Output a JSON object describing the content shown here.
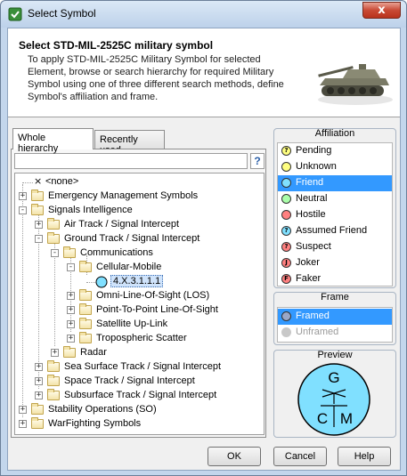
{
  "window": {
    "title": "Select Symbol",
    "close_label": "x"
  },
  "header": {
    "title": "Select STD-MIL-2525C military symbol",
    "description": "To apply STD-MIL-2525C Military Symbol for selected Element, browse or search hierarchy for required Military Symbol using one of three different search methods, define Symbol's affiliation and frame."
  },
  "tabs": [
    "Whole hierarchy",
    "Recently used"
  ],
  "search": {
    "value": "",
    "placeholder": "",
    "help_label": "?"
  },
  "tree": {
    "items": [
      {
        "label": "<none>",
        "level": 0,
        "kind": "none"
      },
      {
        "label": "Emergency Management Symbols",
        "level": 0,
        "kind": "folder",
        "expander": "+"
      },
      {
        "label": "Signals Intelligence",
        "level": 0,
        "kind": "folder",
        "expander": "-"
      },
      {
        "label": "Air Track / Signal Intercept",
        "level": 1,
        "kind": "folder",
        "expander": "+"
      },
      {
        "label": "Ground Track / Signal Intercept",
        "level": 1,
        "kind": "folder",
        "expander": "-"
      },
      {
        "label": "Communications",
        "level": 2,
        "kind": "folder",
        "expander": "-"
      },
      {
        "label": "Cellular-Mobile",
        "level": 3,
        "kind": "folder",
        "expander": "-"
      },
      {
        "label": "4.X.3.1.1.1",
        "level": 4,
        "kind": "symbol",
        "selected": true
      },
      {
        "label": "Omni-Line-Of-Sight (LOS)",
        "level": 3,
        "kind": "folder",
        "expander": "+"
      },
      {
        "label": "Point-To-Point Line-Of-Sight",
        "level": 3,
        "kind": "folder",
        "expander": "+"
      },
      {
        "label": "Satellite Up-Link",
        "level": 3,
        "kind": "folder",
        "expander": "+"
      },
      {
        "label": "Tropospheric Scatter",
        "level": 3,
        "kind": "folder",
        "expander": "+"
      },
      {
        "label": "Radar",
        "level": 2,
        "kind": "folder",
        "expander": "+"
      },
      {
        "label": "Sea Surface Track / Signal Intercept",
        "level": 1,
        "kind": "folder",
        "expander": "+"
      },
      {
        "label": "Space Track / Signal Intercept",
        "level": 1,
        "kind": "folder",
        "expander": "+"
      },
      {
        "label": "Subsurface Track / Signal Intercept",
        "level": 1,
        "kind": "folder",
        "expander": "+"
      },
      {
        "label": "Stability Operations (SO)",
        "level": 0,
        "kind": "folder",
        "expander": "+"
      },
      {
        "label": "WarFighting Symbols",
        "level": 0,
        "kind": "folder",
        "expander": "+"
      }
    ]
  },
  "affiliation": {
    "title": "Affiliation",
    "items": [
      {
        "label": "Pending",
        "color": "#ffff80",
        "glyph": "?"
      },
      {
        "label": "Unknown",
        "color": "#ffff80",
        "glyph": ""
      },
      {
        "label": "Friend",
        "color": "#80e0ff",
        "glyph": "",
        "selected": true
      },
      {
        "label": "Neutral",
        "color": "#aaffaa",
        "glyph": ""
      },
      {
        "label": "Hostile",
        "color": "#ff8080",
        "glyph": ""
      },
      {
        "label": "Assumed Friend",
        "color": "#80e0ff",
        "glyph": "?"
      },
      {
        "label": "Suspect",
        "color": "#ff8080",
        "glyph": "?"
      },
      {
        "label": "Joker",
        "color": "#ff8080",
        "glyph": "J"
      },
      {
        "label": "Faker",
        "color": "#ff8080",
        "glyph": "F"
      }
    ]
  },
  "frame": {
    "title": "Frame",
    "items": [
      {
        "label": "Framed",
        "selected": true,
        "disabled": false
      },
      {
        "label": "Unframed",
        "selected": false,
        "disabled": true
      }
    ]
  },
  "preview": {
    "title": "Preview",
    "letters": [
      "G",
      "C",
      "M"
    ],
    "fill": "#80e0ff"
  },
  "buttons": {
    "ok": "OK",
    "cancel": "Cancel",
    "help": "Help"
  }
}
